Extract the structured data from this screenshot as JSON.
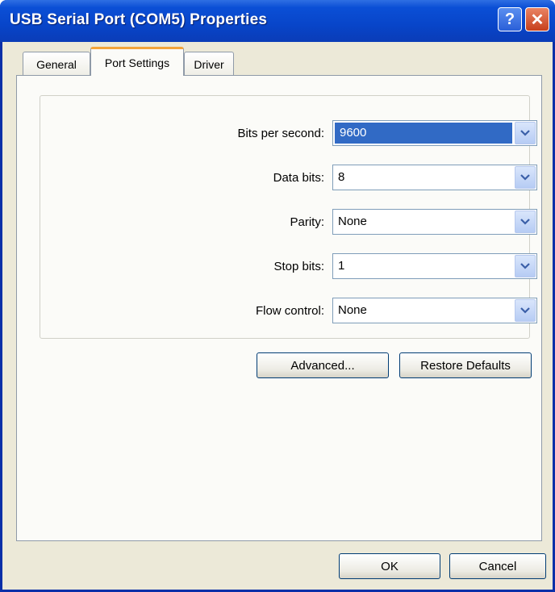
{
  "window": {
    "title": "USB Serial Port (COM5) Properties",
    "help_glyph": "?",
    "close_glyph": "✕"
  },
  "tabs": [
    {
      "label": "General"
    },
    {
      "label": "Port Settings",
      "active": true
    },
    {
      "label": "Driver"
    }
  ],
  "settings": {
    "bits_per_second": {
      "label": "Bits per second:",
      "value": "9600"
    },
    "data_bits": {
      "label": "Data bits:",
      "value": "8"
    },
    "parity": {
      "label": "Parity:",
      "value": "None"
    },
    "stop_bits": {
      "label": "Stop bits:",
      "value": "1"
    },
    "flow_control": {
      "label": "Flow control:",
      "value": "None"
    }
  },
  "buttons": {
    "advanced": "Advanced...",
    "restore_defaults": "Restore Defaults",
    "ok": "OK",
    "cancel": "Cancel"
  },
  "colors": {
    "titlebar": "#0845c9",
    "selection": "#316ac5",
    "dialog_bg": "#ece9d8"
  },
  "icons": {
    "help": "help-icon",
    "close": "close-icon",
    "dropdown": "chevron-down-icon"
  }
}
